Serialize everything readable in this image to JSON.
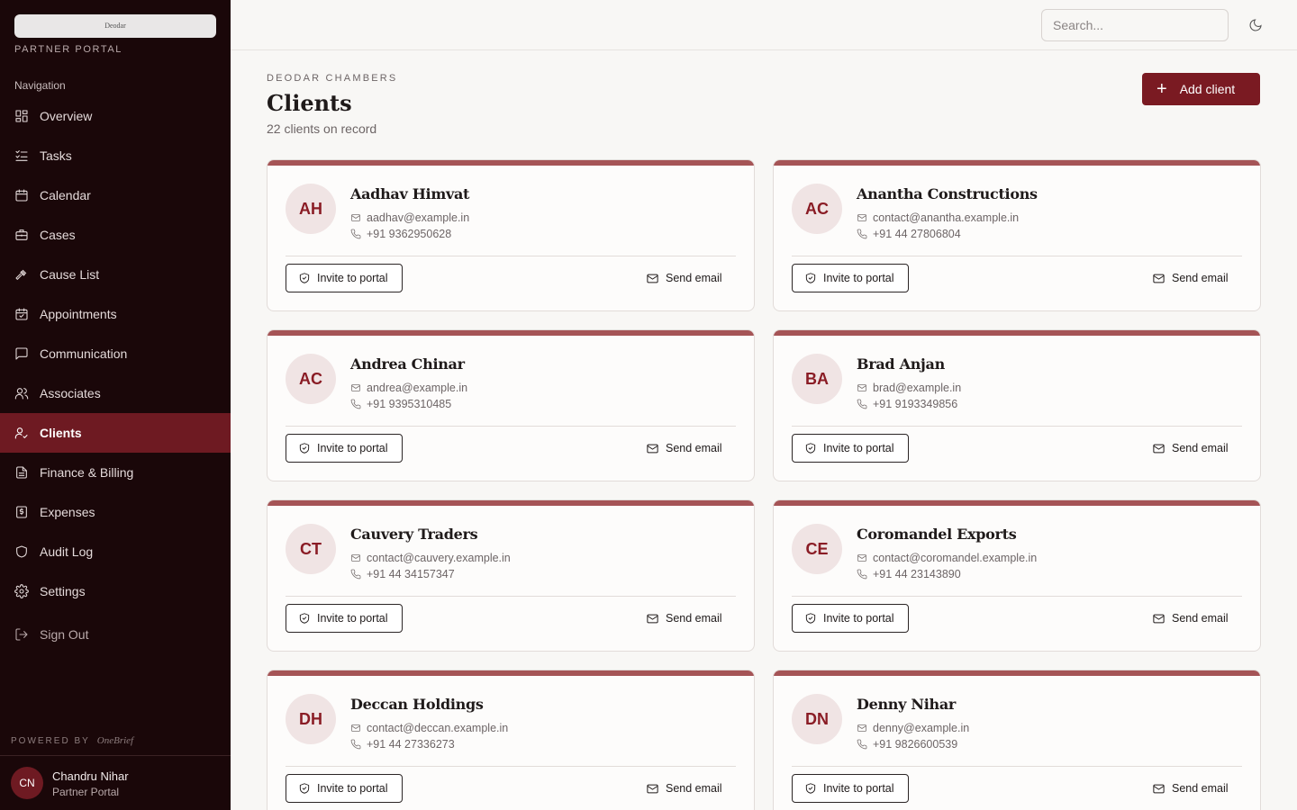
{
  "sidebar": {
    "logo_text": "Deodar",
    "portal_label": "PARTNER PORTAL",
    "nav_heading": "Navigation",
    "items": [
      {
        "label": "Overview",
        "icon": "grid-icon"
      },
      {
        "label": "Tasks",
        "icon": "list-check-icon"
      },
      {
        "label": "Calendar",
        "icon": "calendar-icon"
      },
      {
        "label": "Cases",
        "icon": "briefcase-icon"
      },
      {
        "label": "Cause List",
        "icon": "gavel-icon"
      },
      {
        "label": "Appointments",
        "icon": "calendar-check-icon"
      },
      {
        "label": "Communication",
        "icon": "chat-icon"
      },
      {
        "label": "Associates",
        "icon": "users-icon"
      },
      {
        "label": "Clients",
        "icon": "user-check-icon",
        "active": true
      },
      {
        "label": "Finance & Billing",
        "icon": "document-icon"
      },
      {
        "label": "Expenses",
        "icon": "receipt-icon"
      },
      {
        "label": "Audit Log",
        "icon": "shield-icon"
      },
      {
        "label": "Settings",
        "icon": "gear-icon"
      }
    ],
    "sign_out": "Sign Out",
    "powered_by": "POWERED BY",
    "powered_brand": "OneBrief",
    "user": {
      "initials": "CN",
      "name": "Chandru Nihar",
      "role": "Partner Portal"
    }
  },
  "topbar": {
    "search_placeholder": "Search...",
    "theme_icon": "moon-icon"
  },
  "header": {
    "eyebrow": "DEODAR CHAMBERS",
    "title": "Clients",
    "subtitle": "22 clients on record",
    "add_button": "Add client"
  },
  "card_actions": {
    "invite": "Invite to portal",
    "send": "Send email"
  },
  "clients": [
    {
      "initials": "AH",
      "name": "Aadhav Himvat",
      "email": "aadhav@example.in",
      "phone": "+91 9362950628"
    },
    {
      "initials": "AC",
      "name": "Anantha Constructions",
      "email": "contact@anantha.example.in",
      "phone": "+91 44 27806804"
    },
    {
      "initials": "AC",
      "name": "Andrea Chinar",
      "email": "andrea@example.in",
      "phone": "+91 9395310485"
    },
    {
      "initials": "BA",
      "name": "Brad Anjan",
      "email": "brad@example.in",
      "phone": "+91 9193349856"
    },
    {
      "initials": "CT",
      "name": "Cauvery Traders",
      "email": "contact@cauvery.example.in",
      "phone": "+91 44 34157347"
    },
    {
      "initials": "CE",
      "name": "Coromandel Exports",
      "email": "contact@coromandel.example.in",
      "phone": "+91 44 23143890"
    },
    {
      "initials": "DH",
      "name": "Deccan Holdings",
      "email": "contact@deccan.example.in",
      "phone": "+91 44 27336273"
    },
    {
      "initials": "DN",
      "name": "Denny Nihar",
      "email": "denny@example.in",
      "phone": "+91 9826600539"
    }
  ],
  "colors": {
    "sidebar_bg": "#1a0709",
    "accent": "#7a1a22",
    "card_stripe": "#a55456"
  }
}
